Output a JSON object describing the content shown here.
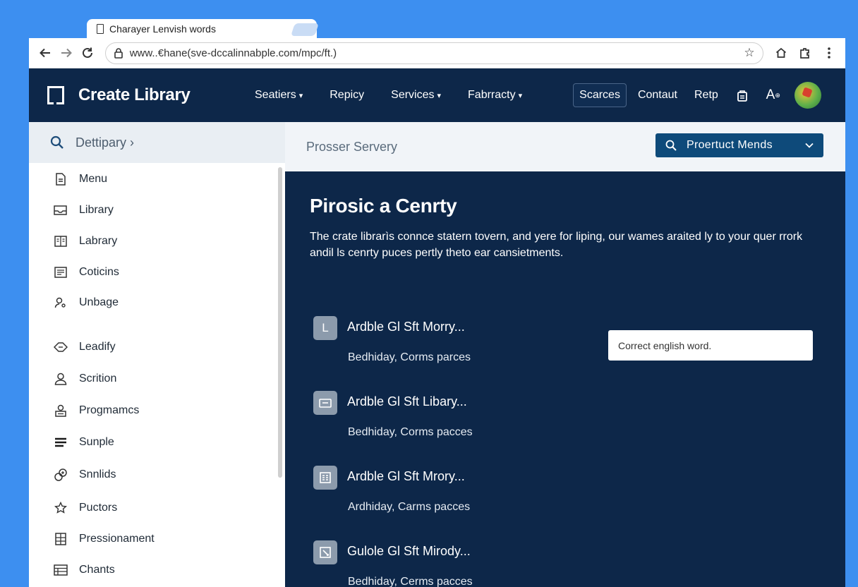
{
  "browser": {
    "tab_title": "Charayer Lenvish words",
    "tab_close": "✕",
    "url": "www..€hane(sve-dccalinnabple.com/mpc/ft.)"
  },
  "header": {
    "brand": "Create Library",
    "nav": [
      "Seatiers",
      "Repicy",
      "Services",
      "Fabrracty"
    ],
    "pill": "Scarces",
    "links": [
      "Contaut",
      "Retp"
    ],
    "font_icon_label": "A"
  },
  "sidebar": {
    "search_label": "Dettipary ›",
    "items": [
      {
        "label": "Menu",
        "icon": "document-icon"
      },
      {
        "label": "Library",
        "icon": "inbox-icon"
      },
      {
        "label": "Labrary",
        "icon": "book-icon"
      },
      {
        "label": "Coticins",
        "icon": "list-card-icon"
      },
      {
        "label": "Unbage",
        "icon": "user-key-icon"
      },
      {
        "label": "Leadify",
        "icon": "diamond-icon"
      },
      {
        "label": "Scrition",
        "icon": "person-icon"
      },
      {
        "label": "Progmamcs",
        "icon": "person-card-icon"
      },
      {
        "label": "Sunple",
        "icon": "lines-icon"
      },
      {
        "label": "Snnlids",
        "icon": "link-icon"
      },
      {
        "label": "Puctors",
        "icon": "star-icon"
      },
      {
        "label": "Pressionament",
        "icon": "grid-icon"
      },
      {
        "label": "Chants",
        "icon": "table-icon"
      }
    ]
  },
  "main": {
    "breadcrumb": "Prosser Servery",
    "product_button": "Proertuct Mends",
    "hero_title": "Pirosic a Cenrty",
    "hero_desc": "The crate librarìs connce statern tovern, and yere for liping, our wames araited ly to your quer rrork andil ls cenrty puces pertly theto ear cansietments.",
    "tooltip": "Correct english word.",
    "cards": [
      {
        "title": "Ardble Gl Sft Morry...",
        "subtitle": "Bedhiday, Corms parces",
        "icon": "letter-l-icon",
        "glyph": "L"
      },
      {
        "title": "Ardble Gl Sft Libary...",
        "subtitle": "Bedhiday, Corms pacces",
        "icon": "mail-icon"
      },
      {
        "title": "Ardble Gl Sft Mrory...",
        "subtitle": "Ardhiday, Carms pacces",
        "icon": "form-icon"
      },
      {
        "title": "Gulole Gl Sft Mirody...",
        "subtitle": "Bedhiday, Cerms pacces",
        "icon": "edit-icon"
      }
    ]
  },
  "colors": {
    "background": "#3d8ff0",
    "header_navy": "#0d2749",
    "button_blue": "#0e4a7a",
    "card_icon_bg": "#8c9bac"
  }
}
